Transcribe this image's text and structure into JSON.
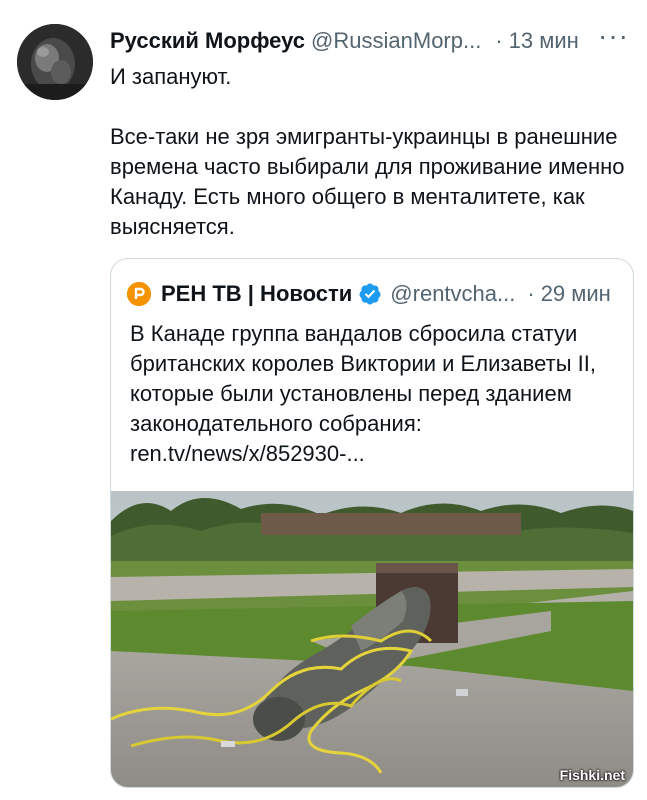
{
  "tweet": {
    "author_name": "Русский Морфеус",
    "handle": "@RussianMorp...",
    "separator": "·",
    "time": "13 мин",
    "more_label": "···",
    "text_line1": "И запануют.",
    "text_para2": "Все-таки не зря эмигранты-украинцы в ранешние времена часто выбирали для проживание именно Канаду. Есть много общего в менталитете, как выясняется."
  },
  "quote": {
    "name": "РЕН ТВ | Новости",
    "handle": "@rentvcha...",
    "separator": "·",
    "time": "29 мин",
    "text": "В Канаде группа вандалов сбросила статуи британских королев Виктории и Елизаветы II, которые были установлены перед зданием законодательного собрания:",
    "link": "ren.tv/news/x/852930-..."
  },
  "watermark": "Fishki.net",
  "colors": {
    "text_primary": "#0f1419",
    "text_secondary": "#536471",
    "verified_blue": "#1d9bf0",
    "logo_orange": "#f59300",
    "border": "#cfd9de"
  }
}
